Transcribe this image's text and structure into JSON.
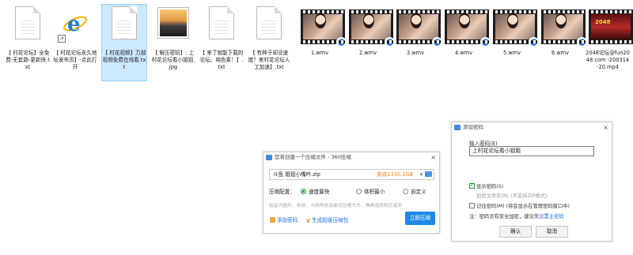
{
  "files": [
    {
      "kind": "txt",
      "name": "【 村花论坛】全免费-无套路-更新快.txt",
      "selected": false
    },
    {
      "kind": "url",
      "name": "【 村花论坛永久地址发布页】-点此打开",
      "selected": false
    },
    {
      "kind": "txt",
      "name": "【 村花视频】万部视频免费在线看.txt",
      "selected": true
    },
    {
      "kind": "jpg",
      "name": "【 解压密码】: 上村花论坛看小姐姐.jpg",
      "selected": false
    },
    {
      "kind": "txt",
      "name": "【 来了就能下载的论坛。纯色素！】.txt",
      "selected": false
    },
    {
      "kind": "txt",
      "name": "【 有种子却没速度？来村花论坛人工加速】.txt",
      "selected": false
    },
    {
      "kind": "video",
      "name": "1.wmv",
      "selected": false
    },
    {
      "kind": "video",
      "name": "2.wmv",
      "selected": false
    },
    {
      "kind": "video",
      "name": "3.wmv",
      "selected": false
    },
    {
      "kind": "video",
      "name": "4.wmv",
      "selected": false
    },
    {
      "kind": "video",
      "name": "5.wmv",
      "selected": false
    },
    {
      "kind": "video",
      "name": "6.wmv",
      "selected": false
    },
    {
      "kind": "mp4",
      "name": "2048论坛@fun2048.com -200314-20.mp4",
      "selected": false
    }
  ],
  "compress_dialog": {
    "title": "您将创建一个压缩文件 - 360压缩",
    "filename": "斗鱼 姐姐小嘴吟.zip",
    "size": "剩余2330.1GB",
    "mode_label": "压缩配置：",
    "modes": [
      {
        "label": "速度最快",
        "selected": true
      },
      {
        "label": "体积最小",
        "selected": false
      },
      {
        "label": "自定义",
        "selected": false
      }
    ],
    "hint": "智能为图片、视频、文档等挑选最优压缩方式，兼具速度和压缩率",
    "add_password": "添加密码",
    "make_super": "生成超级压缩包",
    "confirm": "立即压缩",
    "close": "×",
    "brand_mark": "V"
  },
  "password_dialog": {
    "title": "添加密码",
    "label": "输入密码(E)",
    "value": "上村花论坛看小姐姐",
    "show_password": "显示密码(S)",
    "show_password_checked": true,
    "encrypt_names": "加密文件名(N) (不支持ZIP格式)",
    "remember": "记住密码(M) (将会显示在管理密码窗口中)",
    "remember_checked": false,
    "note_prefix": "注：密码没有安全加密，建议先",
    "note_link": "设置主密码",
    "ok": "确认",
    "cancel": "取消",
    "close": "×"
  },
  "glyphs": {
    "ie": "e",
    "shortcut_arrow": "↗",
    "video_badge": "↻",
    "dropdown": "▾",
    "mp4_brand": "2048"
  },
  "colors": {
    "selection": "#cce8ff",
    "primary_button": "#1e88e5",
    "link": "#1e6fd9",
    "size_text": "#ff7e1a"
  }
}
